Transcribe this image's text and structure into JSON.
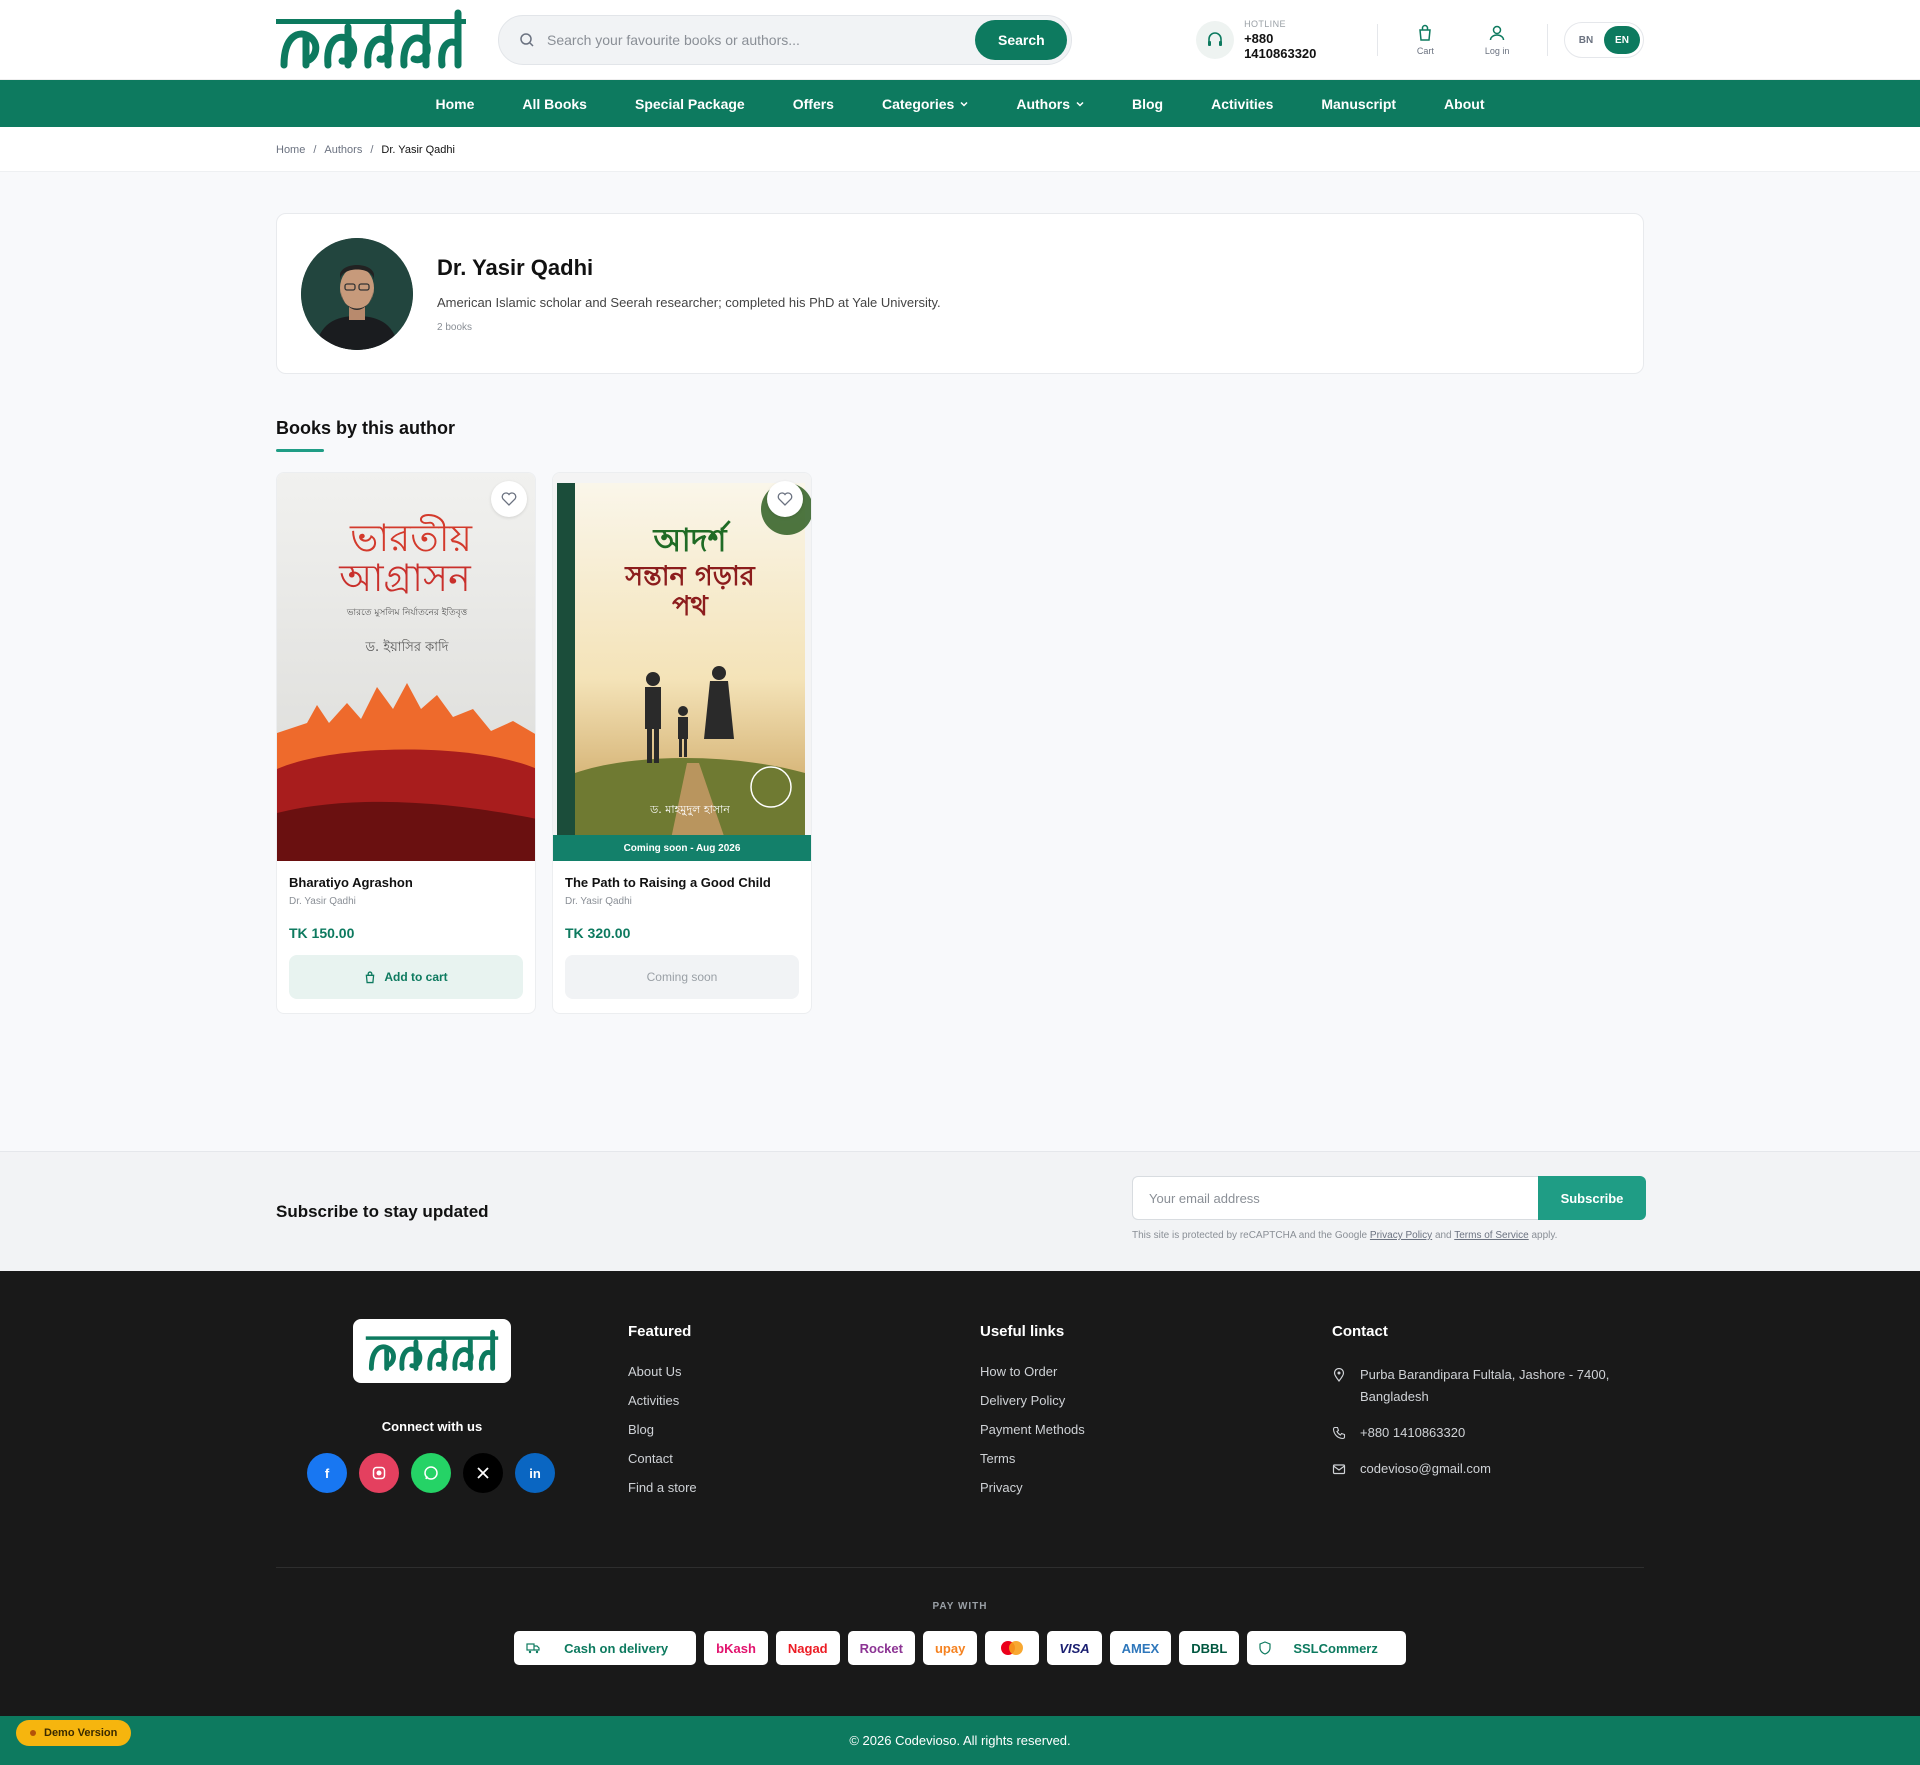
{
  "header": {
    "search_placeholder": "Search your favourite books or authors...",
    "search_button": "Search",
    "hotline_label": "HOTLINE",
    "hotline_number": "+880 1410863320",
    "cart_label": "Cart",
    "login_label": "Log in",
    "lang_bn": "BN",
    "lang_en": "EN",
    "active_lang": "EN"
  },
  "nav": [
    {
      "label": "Home"
    },
    {
      "label": "All Books"
    },
    {
      "label": "Special Package"
    },
    {
      "label": "Offers"
    },
    {
      "label": "Categories",
      "dropdown": true
    },
    {
      "label": "Authors",
      "dropdown": true
    },
    {
      "label": "Blog"
    },
    {
      "label": "Activities"
    },
    {
      "label": "Manuscript"
    },
    {
      "label": "About"
    }
  ],
  "breadcrumb": {
    "home": "Home",
    "authors": "Authors",
    "current": "Dr. Yasir Qadhi",
    "separator": "/"
  },
  "author": {
    "name": "Dr. Yasir Qadhi",
    "bio": "American Islamic scholar and Seerah researcher; completed his PhD at Yale University.",
    "count": "2 books"
  },
  "books_section": {
    "title": "Books by this author",
    "books": [
      {
        "title": "Bharatiyo Agrashon",
        "author": "Dr. Yasir Qadhi",
        "price": "TK 150.00",
        "button": "Add to cart",
        "cover_title_line1": "ভারতীয়",
        "cover_title_line2": "আগ্রাসন",
        "cover_subtitle": "ভারতে মুসলিম নির্যাতনের ইতিবৃত্ত",
        "cover_author": "ড. ইয়াসির কাদি"
      },
      {
        "title": "The Path to Raising a Good Child",
        "author": "Dr. Yasir Qadhi",
        "price": "TK 320.00",
        "button": "Coming soon",
        "badge": "Coming soon - Aug 2026",
        "cover_title_line1": "আদর্শ",
        "cover_title_line2": "সন্তান গড়ার",
        "cover_title_line3": "পথ",
        "cover_author": "ড. মাহমুদুল হাসান"
      }
    ]
  },
  "subscribe": {
    "title": "Subscribe to stay updated",
    "placeholder": "Your email address",
    "button": "Subscribe",
    "note_prefix": "This site is protected by reCAPTCHA and the Google",
    "privacy": "Privacy Policy",
    "and": "and",
    "terms": "Terms of Service",
    "note_suffix": "apply."
  },
  "footer": {
    "connect": "Connect with us",
    "socials": [
      "facebook",
      "instagram",
      "whatsapp",
      "x",
      "linkedin"
    ],
    "featured": {
      "title": "Featured",
      "links": [
        "About Us",
        "Activities",
        "Blog",
        "Contact",
        "Find a store"
      ]
    },
    "useful": {
      "title": "Useful links",
      "links": [
        "How to Order",
        "Delivery Policy",
        "Payment Methods",
        "Terms",
        "Privacy"
      ]
    },
    "contact": {
      "title": "Contact",
      "address": "Purba Barandipara Fultala, Jashore - 7400, Bangladesh",
      "phone": "+880 1410863320",
      "email": "codevioso@gmail.com"
    },
    "pay_with": "PAY WITH",
    "payments": [
      "Cash on delivery",
      "bKash",
      "Nagad",
      "Rocket",
      "upay",
      "Mastercard",
      "VISA",
      "AMEX",
      "DBBL",
      "SSLCommerz"
    ],
    "copyright": "© 2026 Codevioso. All rights reserved.",
    "demo": "Demo Version"
  },
  "colors": {
    "brand": "#0d7a5f",
    "accent": "#1f9d85",
    "footer_bg": "#191919",
    "demo": "#f6b50e"
  }
}
